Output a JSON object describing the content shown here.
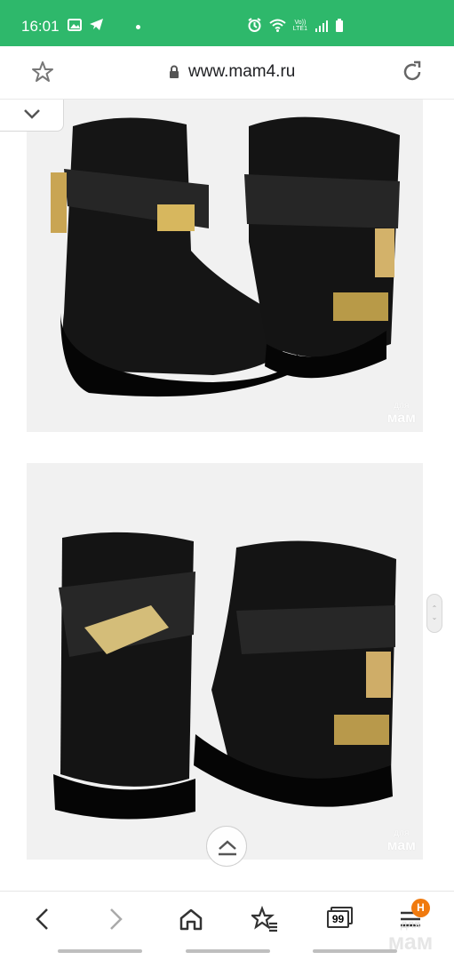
{
  "status_bar": {
    "time": "16:01",
    "network_label_top": "Vo))",
    "network_label_bottom": "LTE1"
  },
  "browser": {
    "url": "www.mam4.ru"
  },
  "watermarks": {
    "small": "для",
    "large": "мам"
  },
  "bottom_navigation": {
    "tab_count": "99",
    "notification_badge": "H"
  },
  "colors": {
    "status_bar": "#2eb86b",
    "badge": "#f07a0e"
  }
}
